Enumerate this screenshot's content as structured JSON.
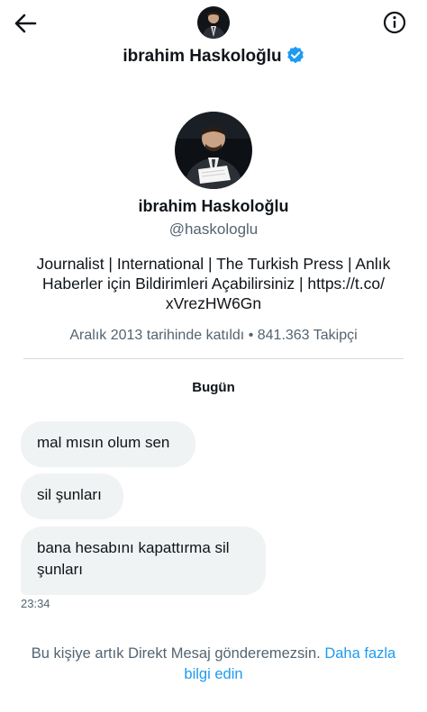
{
  "header": {
    "name": "ibrahim Haskoloğlu",
    "back_icon": "back-arrow-icon",
    "info_icon": "info-icon",
    "verified_icon": "verified-badge-icon"
  },
  "profile": {
    "name": "ibrahim Haskoloğlu",
    "handle": "@haskologlu",
    "bio_line1": "Journalist | International | The Turkish Press | Anlık",
    "bio_line2": "Haberler için Bildirimleri Açabilirsiniz | https://t.co/",
    "bio_line3": "xVrezHW6Gn",
    "meta": "Aralık 2013 tarihinde katıldı • 841.363 Takipçi"
  },
  "conversation": {
    "date_separator": "Bugün",
    "messages": [
      {
        "text": "mal mısın olum sen"
      },
      {
        "text": "sil şunları"
      },
      {
        "text_line1": "bana hesabını kapattırma sil",
        "text_line2": "şunları"
      }
    ],
    "time": "23:34"
  },
  "notice": {
    "text": "Bu kişiye artık Direkt Mesaj gönderemezsin.",
    "link_part1": "Daha fazla",
    "link_part2": "bilgi edin"
  },
  "colors": {
    "link": "#1d9bf0",
    "verified": "#1d9bf0",
    "bubble": "#eff3f4",
    "secondary_text": "#536471"
  }
}
